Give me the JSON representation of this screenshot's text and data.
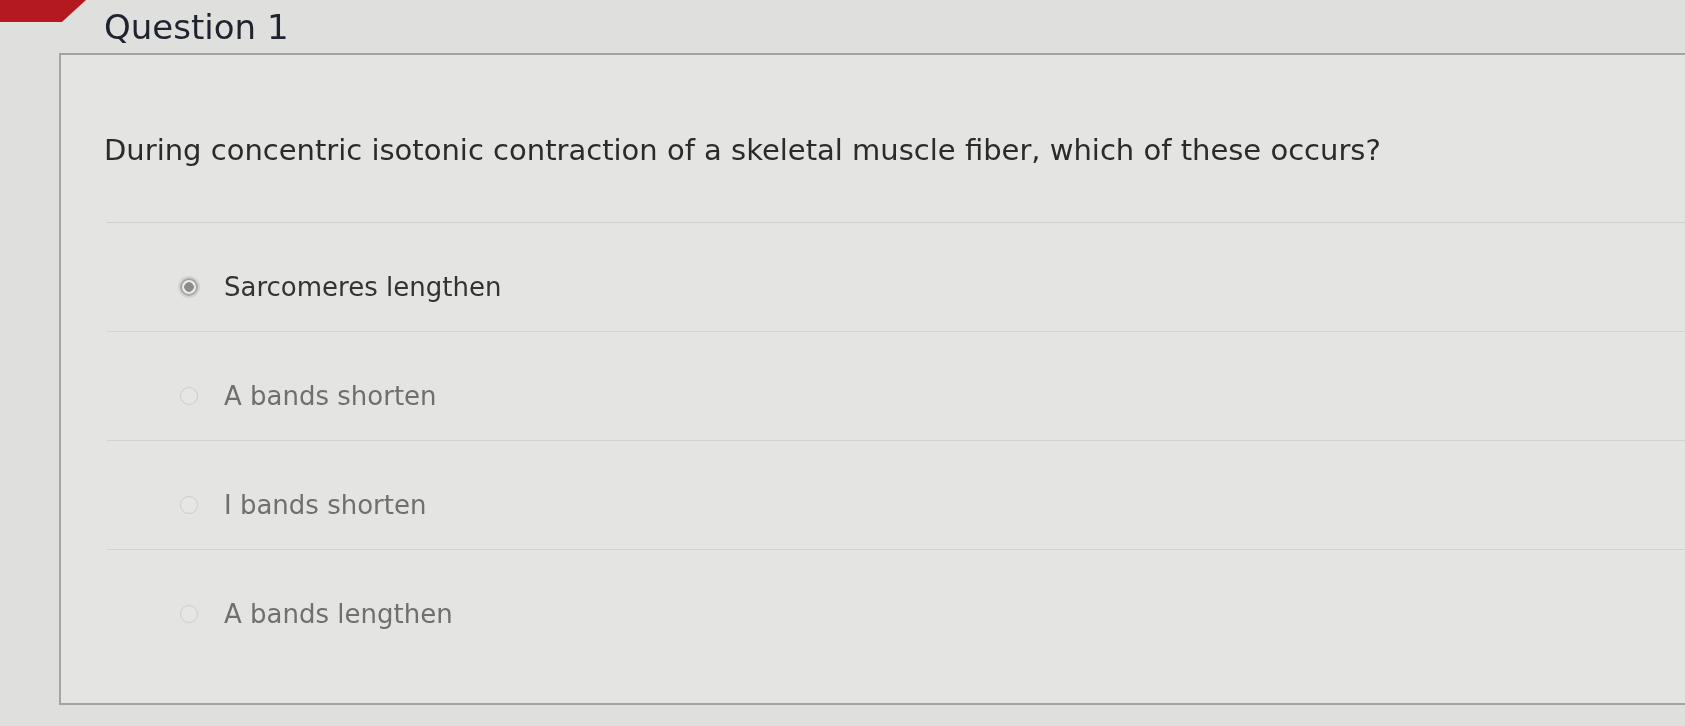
{
  "header": {
    "title": "Question 1"
  },
  "question": {
    "text": "During concentric isotonic contraction of a skeletal muscle fiber, which of these occurs?"
  },
  "options": [
    {
      "label": "Sarcomeres lengthen",
      "selected": true
    },
    {
      "label": "A bands shorten",
      "selected": false
    },
    {
      "label": "I bands shorten",
      "selected": false
    },
    {
      "label": "A bands lengthen",
      "selected": false
    }
  ]
}
